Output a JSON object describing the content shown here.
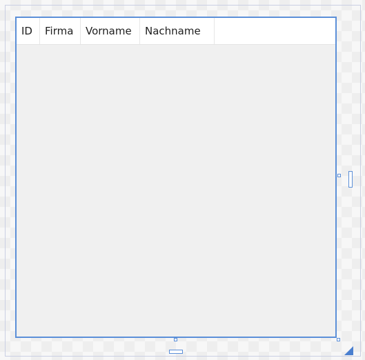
{
  "listview": {
    "columns": [
      {
        "label": "ID"
      },
      {
        "label": "Firma"
      },
      {
        "label": "Vorname"
      },
      {
        "label": "Nachname"
      }
    ],
    "rows": []
  },
  "colors": {
    "selection": "#5b8fd8",
    "control_bg": "#f0f0f0",
    "header_bg": "#ffffff"
  },
  "icons": {
    "resize_corner": "resize-grip-icon"
  }
}
